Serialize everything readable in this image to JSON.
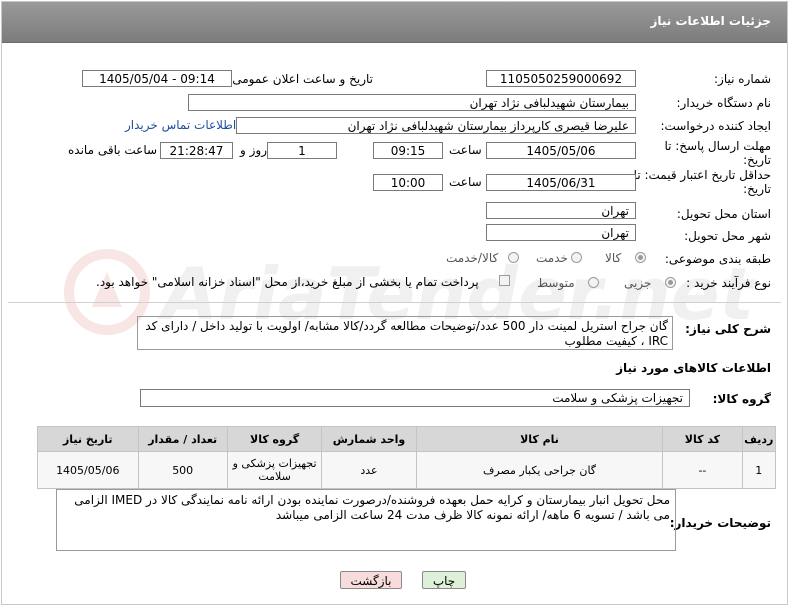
{
  "header": {
    "title": "جزئیات اطلاعات نیاز"
  },
  "fields": {
    "need_number_label": "شماره نیاز:",
    "need_number": "1105050259000692",
    "announce_label": "تاریخ و ساعت اعلان عمومی:",
    "announce_value": "1405/05/04 - 09:14",
    "buyer_org_label": "نام دستگاه خریدار:",
    "buyer_org": "بیمارستان شهیدلبافی نژاد تهران",
    "requester_label": "ایجاد کننده درخواست:",
    "requester": "علیرضا قیصری کارپرداز بیمارستان شهیدلبافی نژاد تهران",
    "contact_link": "اطلاعات تماس خریدار",
    "deadline_label": "مهلت ارسال پاسخ: تا تاریخ:",
    "deadline_date": "1405/05/06",
    "time_label": "ساعت",
    "deadline_time": "09:15",
    "days_value": "1",
    "days_label": "روز و",
    "remaining_time": "21:28:47",
    "remaining_label": "ساعت باقی مانده",
    "min_price_label": "حداقل تاریخ اعتبار قیمت: تا تاریخ:",
    "min_price_date": "1405/06/31",
    "min_price_time_label": "ساعت",
    "min_price_time": "10:00",
    "province_label": "استان محل تحویل:",
    "province": "تهران",
    "city_label": "شهر محل تحویل:",
    "city": "تهران",
    "category_label": "طبقه بندی موضوعی:",
    "category_options": [
      "کالا",
      "خدمت",
      "کالا/خدمت"
    ],
    "process_label": "نوع فرآیند خرید :",
    "process_options": [
      "جزیی",
      "متوسط"
    ],
    "payment_note": "پرداخت تمام یا بخشی از مبلغ خرید،از محل \"اسناد خزانه اسلامی\" خواهد بود."
  },
  "description": {
    "label": "شرح کلی نیاز:",
    "text": "گان جراح استریل لمینت دار  500 عدد/توضیحات مطالعه گردد/کالا مشابه/ اولویت با تولید داخل / دارای کد IRC ، کیفیت مطلوب"
  },
  "goods_info": {
    "title": "اطلاعات کالاهای مورد نیاز",
    "group_label": "گروه کالا:",
    "group_value": "تجهیزات پزشکی و سلامت"
  },
  "table": {
    "headers": [
      "ردیف",
      "کد کالا",
      "نام کالا",
      "واحد شمارش",
      "گروه کالا",
      "تعداد / مقدار",
      "تاریخ نیاز"
    ],
    "rows": [
      [
        "1",
        "--",
        "گان جراحی یکبار مصرف",
        "عدد",
        "تجهیزات پزشکی و سلامت",
        "500",
        "1405/05/06"
      ]
    ]
  },
  "buyer_notes": {
    "label": "توضیحات خریدار:",
    "text": "محل تحویل انبار بیمارستان و کرایه حمل بعهده فروشنده/درصورت نماینده بودن ارائه نامه نمایندگی کالا در  IMED الزامی می باشد / تسویه 6 ماهه/ ارائه نمونه کالا ظرف مدت 24 ساعت الزامی میباشد"
  },
  "buttons": {
    "print": "چاپ",
    "back": "بازگشت"
  },
  "colors": {
    "header_bg": "#8a8a8a",
    "link": "#1f4f9f",
    "back_btn": "#f8dcdc",
    "print_btn": "#dff0d8"
  }
}
